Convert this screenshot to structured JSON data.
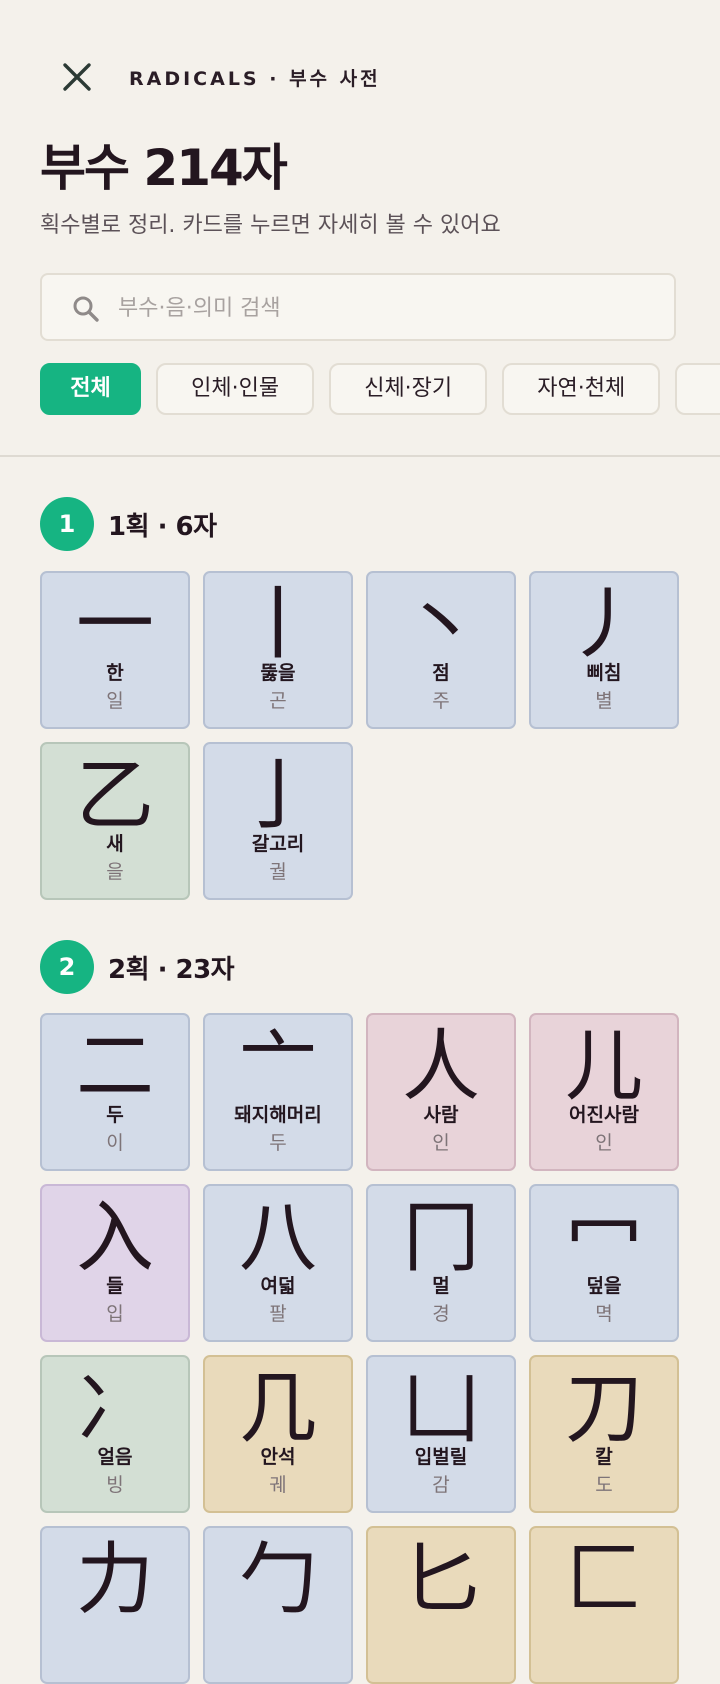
{
  "header": {
    "brand": "RADICALS · 부수 사전",
    "title": "부수 214자",
    "subtitle": "획수별로 정리. 카드를 누르면 자세히 볼 수 있어요",
    "close_icon": "close-icon"
  },
  "search": {
    "placeholder": "부수·음·의미 검색",
    "value": "",
    "icon": "search-icon"
  },
  "filters": [
    {
      "label": "전체",
      "active": true
    },
    {
      "label": "인체·인물",
      "active": false
    },
    {
      "label": "신체·장기",
      "active": false
    },
    {
      "label": "자연·천체",
      "active": false
    }
  ],
  "colors": {
    "accent": "#16b482",
    "blue": "#d3dbe8",
    "green": "#d3dfd4",
    "pink": "#e8d3d9",
    "purple": "#e0d4e8",
    "sand": "#e9dabb"
  },
  "sections": [
    {
      "badge": "1",
      "label": "1획 · 6자",
      "cards": [
        {
          "glyph": "一",
          "name": "한",
          "reading": "일",
          "color": "blue"
        },
        {
          "glyph": "丨",
          "name": "뚫을",
          "reading": "곤",
          "color": "blue"
        },
        {
          "glyph": "丶",
          "name": "점",
          "reading": "주",
          "color": "blue"
        },
        {
          "glyph": "丿",
          "name": "삐침",
          "reading": "별",
          "color": "blue"
        },
        {
          "glyph": "乙",
          "name": "새",
          "reading": "을",
          "color": "green"
        },
        {
          "glyph": "亅",
          "name": "갈고리",
          "reading": "궐",
          "color": "blue"
        }
      ]
    },
    {
      "badge": "2",
      "label": "2획 · 23자",
      "cards": [
        {
          "glyph": "二",
          "name": "두",
          "reading": "이",
          "color": "blue"
        },
        {
          "glyph": "亠",
          "name": "돼지해머리",
          "reading": "두",
          "color": "blue"
        },
        {
          "glyph": "人",
          "name": "사람",
          "reading": "인",
          "color": "pink"
        },
        {
          "glyph": "儿",
          "name": "어진사람",
          "reading": "인",
          "color": "pink"
        },
        {
          "glyph": "入",
          "name": "들",
          "reading": "입",
          "color": "purple"
        },
        {
          "glyph": "八",
          "name": "여덟",
          "reading": "팔",
          "color": "blue"
        },
        {
          "glyph": "冂",
          "name": "멀",
          "reading": "경",
          "color": "blue"
        },
        {
          "glyph": "冖",
          "name": "덮을",
          "reading": "멱",
          "color": "blue"
        },
        {
          "glyph": "冫",
          "name": "얼음",
          "reading": "빙",
          "color": "green"
        },
        {
          "glyph": "几",
          "name": "안석",
          "reading": "궤",
          "color": "sand"
        },
        {
          "glyph": "凵",
          "name": "입벌릴",
          "reading": "감",
          "color": "blue"
        },
        {
          "glyph": "刀",
          "name": "칼",
          "reading": "도",
          "color": "sand"
        },
        {
          "glyph": "力",
          "name": "",
          "reading": "",
          "color": "blue"
        },
        {
          "glyph": "勹",
          "name": "",
          "reading": "",
          "color": "blue"
        },
        {
          "glyph": "匕",
          "name": "",
          "reading": "",
          "color": "sand"
        },
        {
          "glyph": "匚",
          "name": "",
          "reading": "",
          "color": "sand"
        }
      ]
    }
  ]
}
